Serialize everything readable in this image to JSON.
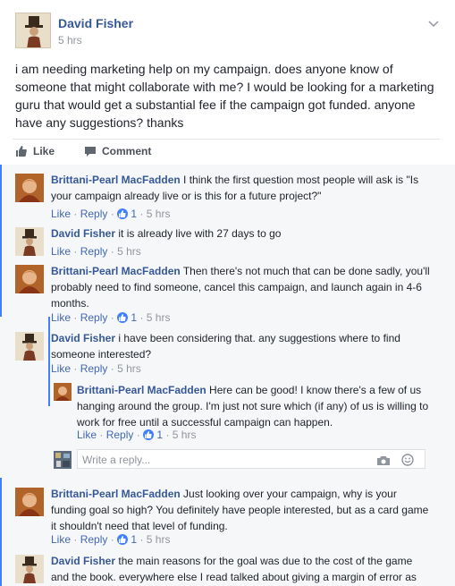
{
  "post": {
    "author": "David Fisher",
    "time": "5 hrs",
    "text": "i am needing marketing help on my campaign. does anyone know of someone that might collaborate with me? I would be looking for a marketing guru that would get a substantial fee if the campaign got funded. anyone have any suggestions? thanks",
    "actions": {
      "like": "Like",
      "comment": "Comment"
    }
  },
  "comments": [
    {
      "author": "Brittani-Pearl MacFadden",
      "text": "I think the first question most people will ask is \"Is your campaign already live or is this for a future project?\"",
      "like": "Like",
      "sep": "·",
      "reply": "Reply",
      "likes": "1",
      "time": "5 hrs"
    },
    {
      "author": "David Fisher",
      "text": "it is already live with 27 days to go",
      "like": "Like",
      "sep": "·",
      "reply": "Reply",
      "time": "5 hrs"
    },
    {
      "author": "Brittani-Pearl MacFadden",
      "text": "Then there's not much that can be done sadly, you'll probably need to find someone, cancel this campaign, and launch again in 4-6 months.",
      "like": "Like",
      "sep": "·",
      "reply": "Reply",
      "likes": "1",
      "time": "5 hrs"
    },
    {
      "author": "David Fisher",
      "text": "i have been considering that. any suggestions where to find someone interested?",
      "like": "Like",
      "sep": "·",
      "reply": "Reply",
      "time": "5 hrs"
    },
    {
      "author": "Brittani-Pearl MacFadden",
      "text": "Here can be good! I know there's a few of us hanging around the group. I'm just not sure which (if any) of us is willing to work for free until a successful campaign can happen.",
      "like": "Like",
      "sep": "·",
      "reply": "Reply",
      "likes": "1",
      "time": "5 hrs"
    },
    {
      "author": "Brittani-Pearl MacFadden",
      "text": "Just looking over your campaign, why is your funding goal so high? You definitely have people interested, but as a card game it shouldn't need that level of funding.",
      "like": "Like",
      "sep": "·",
      "reply": "Reply",
      "likes": "1",
      "time": "5 hrs"
    },
    {
      "author": "David Fisher",
      "text": "the main reasons for the goal was due to the cost of the game and the book. everywhere else I read talked about giving a margin of error as"
    }
  ],
  "reply_box": {
    "placeholder": "Write a reply..."
  },
  "colors": {
    "link": "#365899",
    "accent": "#4080ff",
    "meta": "#90949c",
    "comments_bg": "#f6f7f9"
  },
  "icons": [
    "man-in-top-hat-avatar",
    "woman-portrait-avatar",
    "thumbs-up-icon",
    "comment-bubble-icon",
    "camera-icon",
    "smile-icon",
    "chevron-down-icon",
    "close-icon"
  ]
}
